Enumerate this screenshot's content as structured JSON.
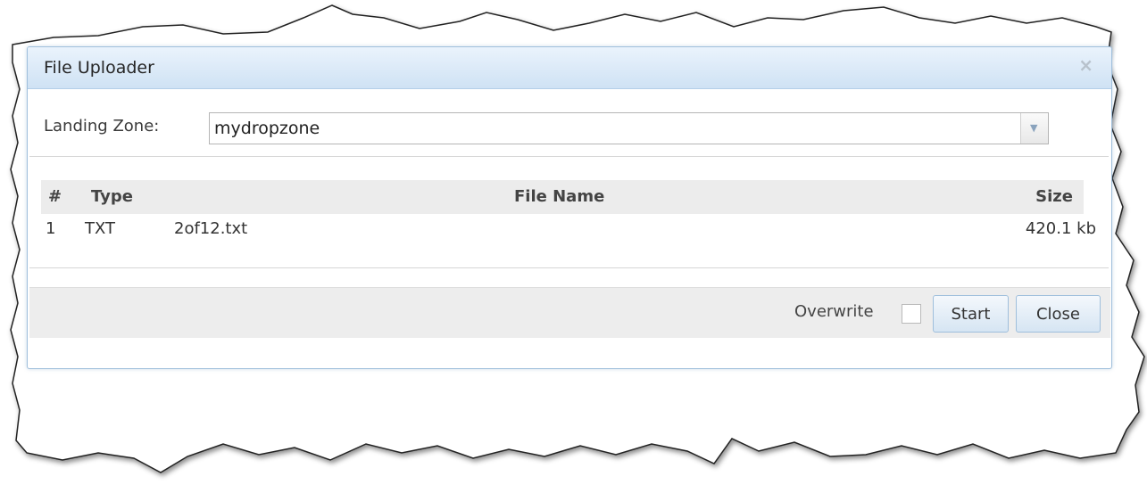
{
  "dialog": {
    "title": "File Uploader",
    "close_glyph": "×"
  },
  "landing_zone": {
    "label": "Landing Zone:",
    "value": "mydropzone"
  },
  "table": {
    "headers": {
      "index": "#",
      "type": "Type",
      "file_name": "File Name",
      "size": "Size"
    },
    "rows": [
      {
        "index": "1",
        "type": "TXT",
        "file_name": "2of12.txt",
        "size": "420.1 kb"
      }
    ]
  },
  "footer": {
    "overwrite_label": "Overwrite",
    "overwrite_checked": false,
    "start_label": "Start",
    "close_label": "Close"
  },
  "colors": {
    "titlebar": "#cfe2f4",
    "border": "#9fbfdc",
    "footer": "#ededed"
  }
}
